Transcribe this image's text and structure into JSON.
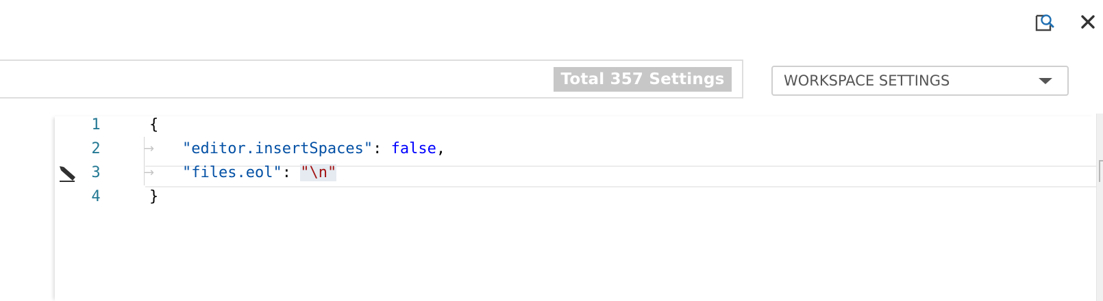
{
  "toolbar": {
    "icons": [
      "search-file-icon",
      "close-icon"
    ]
  },
  "search": {
    "value": "",
    "placeholder": "",
    "count_badge": "Total 357 Settings"
  },
  "scope_select": {
    "selected": "WORKSPACE SETTINGS"
  },
  "editor": {
    "lines": [
      {
        "number": "1",
        "text": "{"
      },
      {
        "number": "2",
        "key": "\"editor.insertSpaces\"",
        "sep": ": ",
        "value": "false",
        "trail": ","
      },
      {
        "number": "3",
        "key": "\"files.eol\"",
        "sep": ": ",
        "value": "\"\\n\"",
        "trail": ""
      },
      {
        "number": "4",
        "text": "}"
      }
    ],
    "indent_marker": "→",
    "edit_glyph": "pencil-icon"
  },
  "colors": {
    "line_number": "#237893",
    "json_key": "#0451a5",
    "json_boolean": "#0000ff",
    "json_string": "#a31515",
    "badge_bg": "#c7c7c7"
  }
}
